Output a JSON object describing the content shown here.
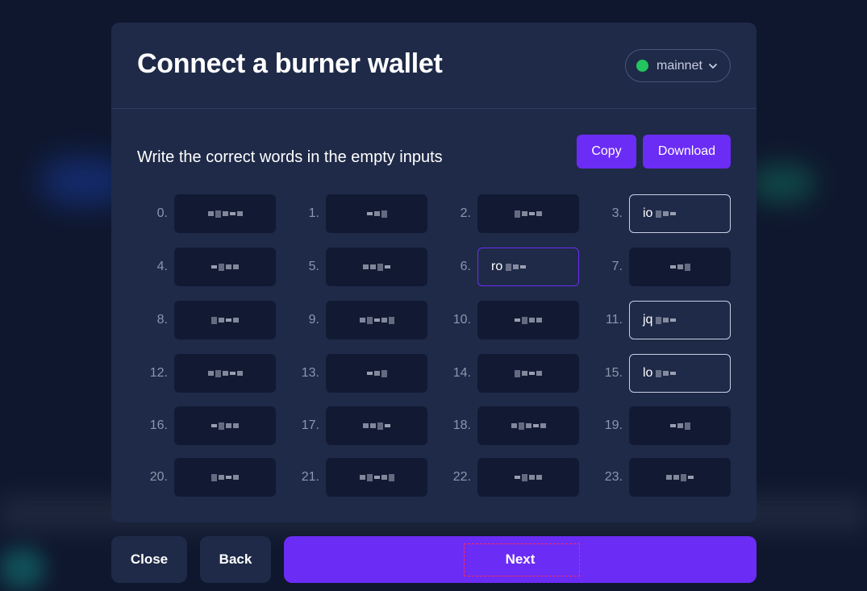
{
  "modal": {
    "title": "Connect a burner wallet",
    "network": {
      "label": "mainnet",
      "status_color": "#22c55e"
    },
    "instruction": "Write the correct words in the empty inputs",
    "copy_label": "Copy",
    "download_label": "Download"
  },
  "words": [
    {
      "index": "0.",
      "type": "hidden"
    },
    {
      "index": "1.",
      "type": "hidden"
    },
    {
      "index": "2.",
      "type": "hidden"
    },
    {
      "index": "3.",
      "type": "input",
      "value": "io"
    },
    {
      "index": "4.",
      "type": "hidden"
    },
    {
      "index": "5.",
      "type": "hidden"
    },
    {
      "index": "6.",
      "type": "input",
      "value": "ro",
      "active": true
    },
    {
      "index": "7.",
      "type": "hidden"
    },
    {
      "index": "8.",
      "type": "hidden"
    },
    {
      "index": "9.",
      "type": "hidden"
    },
    {
      "index": "10.",
      "type": "hidden"
    },
    {
      "index": "11.",
      "type": "input",
      "value": "jq"
    },
    {
      "index": "12.",
      "type": "hidden"
    },
    {
      "index": "13.",
      "type": "hidden"
    },
    {
      "index": "14.",
      "type": "hidden"
    },
    {
      "index": "15.",
      "type": "input",
      "value": "lo"
    },
    {
      "index": "16.",
      "type": "hidden"
    },
    {
      "index": "17.",
      "type": "hidden"
    },
    {
      "index": "18.",
      "type": "hidden"
    },
    {
      "index": "19.",
      "type": "hidden"
    },
    {
      "index": "20.",
      "type": "hidden"
    },
    {
      "index": "21.",
      "type": "hidden"
    },
    {
      "index": "22.",
      "type": "hidden"
    },
    {
      "index": "23.",
      "type": "hidden"
    }
  ],
  "footer": {
    "close_label": "Close",
    "back_label": "Back",
    "next_label": "Next"
  },
  "colors": {
    "accent": "#6b2cf5",
    "panel": "#1f2a48",
    "word_box": "#121a33"
  }
}
